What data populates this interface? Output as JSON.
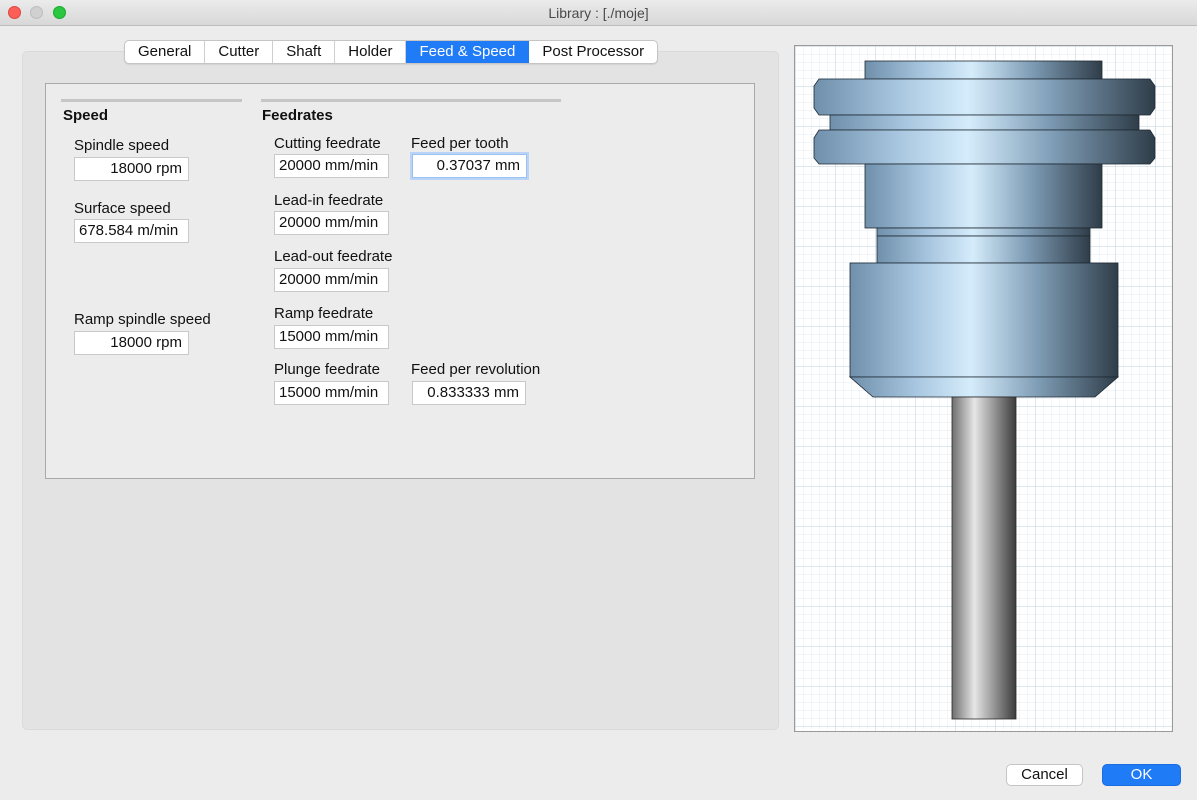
{
  "window": {
    "title": "Library : [./moje]"
  },
  "tabs": [
    {
      "label": "General"
    },
    {
      "label": "Cutter"
    },
    {
      "label": "Shaft"
    },
    {
      "label": "Holder"
    },
    {
      "label": "Feed & Speed",
      "active": true
    },
    {
      "label": "Post Processor"
    }
  ],
  "speed": {
    "title": "Speed",
    "spindle_speed_label": "Spindle speed",
    "spindle_speed_value": "18000 rpm",
    "surface_speed_label": "Surface speed",
    "surface_speed_value": "678.584 m/min",
    "ramp_spindle_speed_label": "Ramp spindle speed",
    "ramp_spindle_speed_value": "18000 rpm"
  },
  "feedrates": {
    "title": "Feedrates",
    "cutting_label": "Cutting feedrate",
    "cutting_value": "20000 mm/min",
    "feed_per_tooth_label": "Feed per tooth",
    "feed_per_tooth_value": "0.37037 mm",
    "lead_in_label": "Lead-in feedrate",
    "lead_in_value": "20000 mm/min",
    "lead_out_label": "Lead-out feedrate",
    "lead_out_value": "20000 mm/min",
    "ramp_label": "Ramp feedrate",
    "ramp_value": "15000 mm/min",
    "plunge_label": "Plunge feedrate",
    "plunge_value": "15000 mm/min",
    "feed_per_rev_label": "Feed per revolution",
    "feed_per_rev_value": "0.833333 mm"
  },
  "buttons": {
    "cancel": "Cancel",
    "ok": "OK"
  },
  "colors": {
    "accent": "#1f7bf6",
    "holder": "#7fa3c2",
    "shaft": "#9a9a9a",
    "grid": "#cfe0ea"
  }
}
